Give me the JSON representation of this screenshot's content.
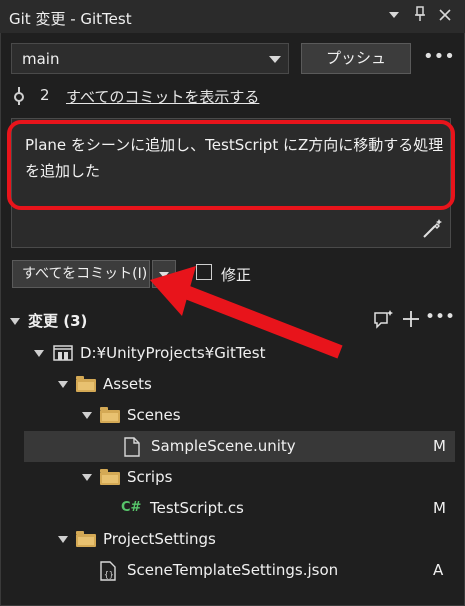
{
  "window": {
    "title": "Git 変更 - GitTest"
  },
  "toolbar": {
    "branch": "main",
    "push_label": "プッシュ",
    "more": "•••"
  },
  "commits": {
    "count": "2",
    "show_all_label": "すべてのコミットを表示する"
  },
  "message": {
    "text": "Plane をシーンに追加し、TestScript にZ方向に移動する処理を追加した"
  },
  "commit": {
    "commit_all_label": "すべてをコミット(I)",
    "amend_label": "修正"
  },
  "changes": {
    "header": "変更 (3)",
    "more": "•••",
    "tree": [
      {
        "label": "D:¥UnityProjects¥GitTest",
        "status": ""
      },
      {
        "label": "Assets",
        "status": ""
      },
      {
        "label": "Scenes",
        "status": ""
      },
      {
        "label": "SampleScene.unity",
        "status": "M"
      },
      {
        "label": "Scrips",
        "status": ""
      },
      {
        "label": "TestScript.cs",
        "status": "M"
      },
      {
        "label": "ProjectSettings",
        "status": ""
      },
      {
        "label": "SceneTemplateSettings.json",
        "status": "A"
      }
    ]
  },
  "colors": {
    "highlight": "#e8141b",
    "background": "#1f1f1f",
    "folder": "#d4a955",
    "csharp": "#57c46a"
  }
}
